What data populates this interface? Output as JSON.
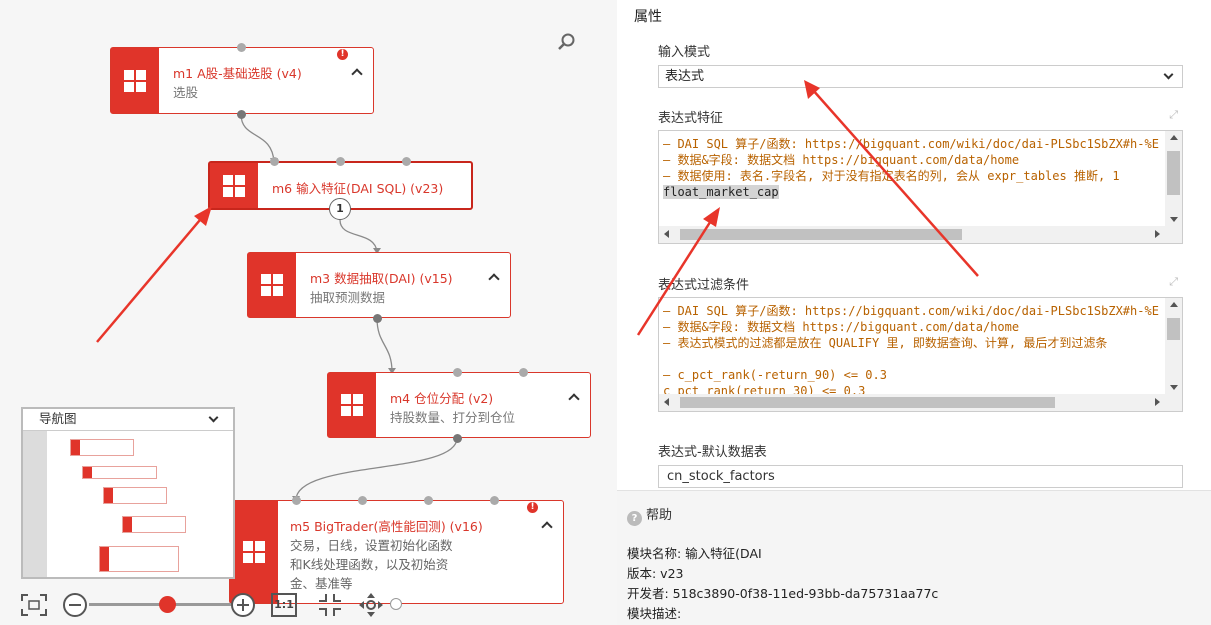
{
  "canvas": {
    "nodes": [
      {
        "id": "m1",
        "title": "m1 A股-基础选股 (v4)",
        "subtitle": "选股",
        "error": "!"
      },
      {
        "id": "m6",
        "title": "m6 输入特征(DAI SQL) (v23)",
        "subtitle": "",
        "badge": "1"
      },
      {
        "id": "m3",
        "title": "m3 数据抽取(DAI) (v15)",
        "subtitle": "抽取预测数据"
      },
      {
        "id": "m4",
        "title": "m4 仓位分配 (v2)",
        "subtitle": "持股数量、打分到仓位"
      },
      {
        "id": "m5",
        "title": "m5 BigTrader(高性能回测) (v16)",
        "subtitle_lines": [
          "交易，日线，设置初始化函数",
          "和K线处理函数，以及初始资",
          "金、基准等"
        ],
        "error": "!"
      }
    ],
    "navigator": {
      "label": "导航图"
    },
    "toolbar": {
      "fit_label": "1:1",
      "zoom_level": 0.55
    }
  },
  "properties": {
    "header": "属性",
    "input_mode": {
      "label": "输入模式",
      "value": "表达式"
    },
    "expr_features": {
      "label": "表达式特征",
      "lines": [
        "— DAI SQL 算子/函数: https://bigquant.com/wiki/doc/dai-PLSbc1SbZX#h-%E",
        "— 数据&字段: 数据文档 https://bigquant.com/data/home",
        "— 数据使用: 表名.字段名, 对于没有指定表名的列, 会从 expr_tables 推断, 1",
        "float_market_cap"
      ]
    },
    "filter": {
      "label": "表达式过滤条件",
      "lines": [
        "— DAI SQL 算子/函数: https://bigquant.com/wiki/doc/dai-PLSbc1SbZX#h-%E",
        "— 数据&字段: 数据文档 https://bigquant.com/data/home",
        "— 表达式模式的过滤都是放在 QUALIFY 里, 即数据查询、计算, 最后才到过滤条",
        "",
        "— c_pct_rank(-return_90) <= 0.3",
        "c_pct_rank(return_30) <= 0.3"
      ]
    },
    "default_table": {
      "label": "表达式-默认数据表",
      "value": "cn_stock_factors"
    }
  },
  "help": {
    "title": "帮助",
    "module_name": "模块名称: 输入特征(DAI",
    "version": "版本: v23",
    "developer": "开发者: 518c3890-0f38-11ed-93bb-da75731aa77c",
    "description": "模块描述:"
  },
  "colors": {
    "accent": "#e0342a",
    "annotation": "#e8352a"
  }
}
